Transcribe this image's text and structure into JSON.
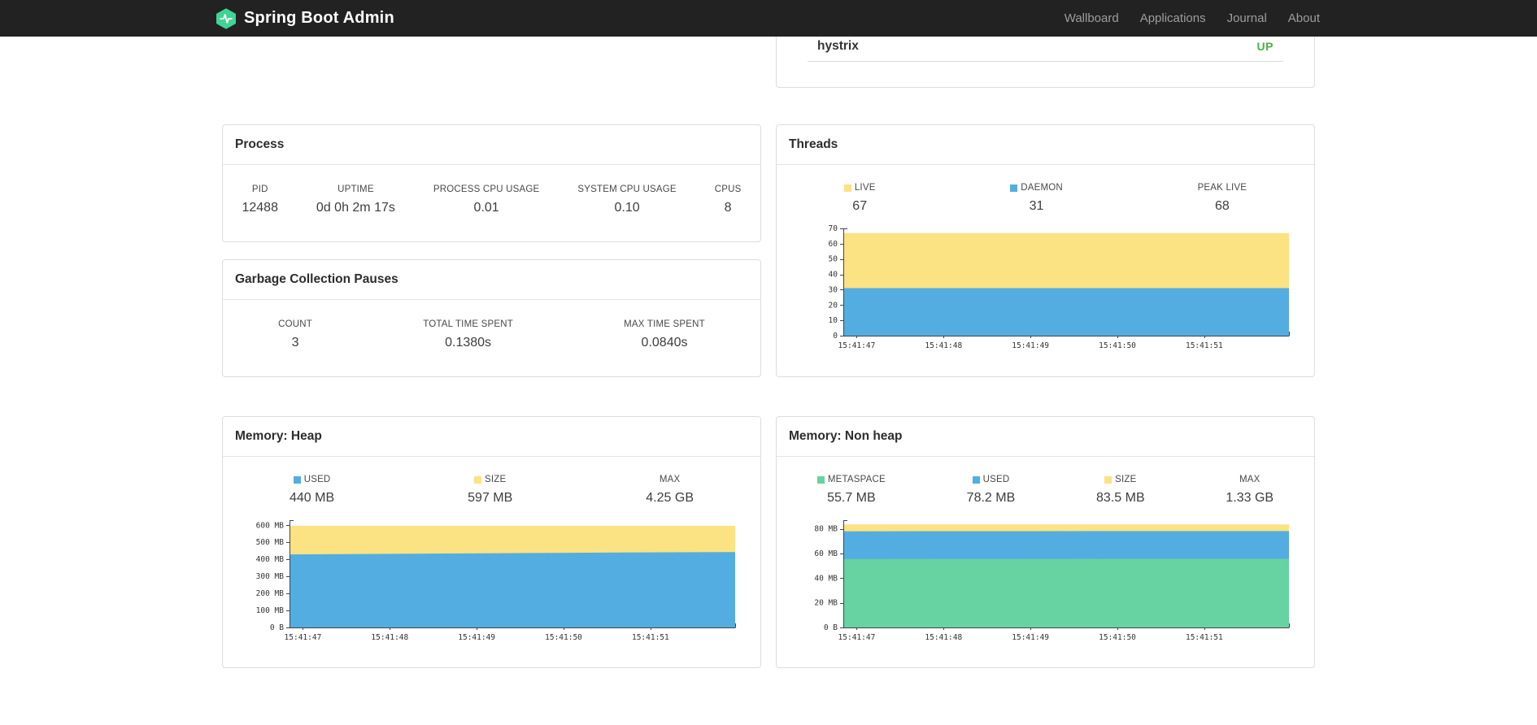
{
  "navbar": {
    "brand": "Spring Boot Admin",
    "links": [
      {
        "label": "Wallboard"
      },
      {
        "label": "Applications"
      },
      {
        "label": "Journal"
      },
      {
        "label": "About"
      }
    ]
  },
  "colors": {
    "navbar_bg": "#222222",
    "brand_green": "#41d296",
    "status_up": "#4cae4c",
    "chart_blue": "#54ade0",
    "chart_yellow": "#fbe283",
    "chart_green": "#67d2a2"
  },
  "applications_panel": {
    "rows": [
      {
        "name": "hystrix",
        "status": "UP"
      }
    ]
  },
  "process": {
    "title": "Process",
    "stats": [
      {
        "label": "PID",
        "value": "12488"
      },
      {
        "label": "UPTIME",
        "value": "0d 0h 2m 17s"
      },
      {
        "label": "PROCESS CPU USAGE",
        "value": "0.01"
      },
      {
        "label": "SYSTEM CPU USAGE",
        "value": "0.10"
      },
      {
        "label": "CPUS",
        "value": "8"
      }
    ]
  },
  "gc": {
    "title": "Garbage Collection Pauses",
    "stats": [
      {
        "label": "COUNT",
        "value": "3"
      },
      {
        "label": "TOTAL TIME SPENT",
        "value": "0.1380s"
      },
      {
        "label": "MAX TIME SPENT",
        "value": "0.0840s"
      }
    ]
  },
  "threads": {
    "title": "Threads",
    "legend": [
      {
        "label": "LIVE",
        "value": "67",
        "color": "#fbe283"
      },
      {
        "label": "DAEMON",
        "value": "31",
        "color": "#54ade0"
      },
      {
        "label": "PEAK LIVE",
        "value": "68"
      }
    ]
  },
  "heap": {
    "title": "Memory: Heap",
    "legend": [
      {
        "label": "USED",
        "value": "440 MB",
        "color": "#54ade0"
      },
      {
        "label": "SIZE",
        "value": "597 MB",
        "color": "#fbe283"
      },
      {
        "label": "MAX",
        "value": "4.25 GB"
      }
    ]
  },
  "nonheap": {
    "title": "Memory: Non heap",
    "legend": [
      {
        "label": "METASPACE",
        "value": "55.7 MB",
        "color": "#67d2a2"
      },
      {
        "label": "USED",
        "value": "78.2 MB",
        "color": "#54ade0"
      },
      {
        "label": "SIZE",
        "value": "83.5 MB",
        "color": "#fbe283"
      },
      {
        "label": "MAX",
        "value": "1.33 GB"
      }
    ]
  },
  "chart_data": [
    {
      "name": "threads",
      "type": "area",
      "x_labels": [
        "15:41:47",
        "15:41:48",
        "15:41:49",
        "15:41:50",
        "15:41:51"
      ],
      "ymax": 70,
      "yticks": [
        {
          "v": 0,
          "label": "0"
        },
        {
          "v": 10,
          "label": "10"
        },
        {
          "v": 20,
          "label": "20"
        },
        {
          "v": 30,
          "label": "30"
        },
        {
          "v": 40,
          "label": "40"
        },
        {
          "v": 50,
          "label": "50"
        },
        {
          "v": 60,
          "label": "60"
        },
        {
          "v": 70,
          "label": "70"
        }
      ],
      "series": [
        {
          "name": "LIVE",
          "color": "#fbe283",
          "values": [
            67,
            67,
            67,
            67,
            67,
            67
          ]
        },
        {
          "name": "DAEMON",
          "color": "#54ade0",
          "values": [
            31,
            31,
            31,
            31,
            31,
            31
          ]
        }
      ]
    },
    {
      "name": "memory-heap",
      "type": "area",
      "x_labels": [
        "15:41:47",
        "15:41:48",
        "15:41:49",
        "15:41:50",
        "15:41:51"
      ],
      "ymax": 630,
      "yticks": [
        {
          "v": 0,
          "label": "0 B"
        },
        {
          "v": 100,
          "label": "100 MB"
        },
        {
          "v": 200,
          "label": "200 MB"
        },
        {
          "v": 300,
          "label": "300 MB"
        },
        {
          "v": 400,
          "label": "400 MB"
        },
        {
          "v": 500,
          "label": "500 MB"
        },
        {
          "v": 600,
          "label": "600 MB"
        }
      ],
      "series": [
        {
          "name": "SIZE",
          "color": "#fbe283",
          "values": [
            597,
            597,
            597,
            597,
            597,
            597
          ]
        },
        {
          "name": "USED",
          "color": "#54ade0",
          "values": [
            429,
            432,
            435,
            438,
            441,
            443
          ]
        }
      ]
    },
    {
      "name": "memory-nonheap",
      "type": "area",
      "x_labels": [
        "15:41:47",
        "15:41:48",
        "15:41:49",
        "15:41:50",
        "15:41:51"
      ],
      "ymax": 87,
      "yticks": [
        {
          "v": 0,
          "label": "0 B"
        },
        {
          "v": 20,
          "label": "20 MB"
        },
        {
          "v": 40,
          "label": "40 MB"
        },
        {
          "v": 60,
          "label": "60 MB"
        },
        {
          "v": 80,
          "label": "80 MB"
        }
      ],
      "series": [
        {
          "name": "SIZE",
          "color": "#fbe283",
          "values": [
            83.5,
            83.5,
            83.5,
            83.5,
            83.5,
            83.5
          ]
        },
        {
          "name": "USED",
          "color": "#54ade0",
          "values": [
            78.0,
            78.1,
            78.1,
            78.2,
            78.2,
            78.2
          ]
        },
        {
          "name": "METASPACE",
          "color": "#67d2a2",
          "values": [
            55.5,
            55.6,
            55.6,
            55.7,
            55.7,
            55.7
          ]
        }
      ]
    }
  ]
}
